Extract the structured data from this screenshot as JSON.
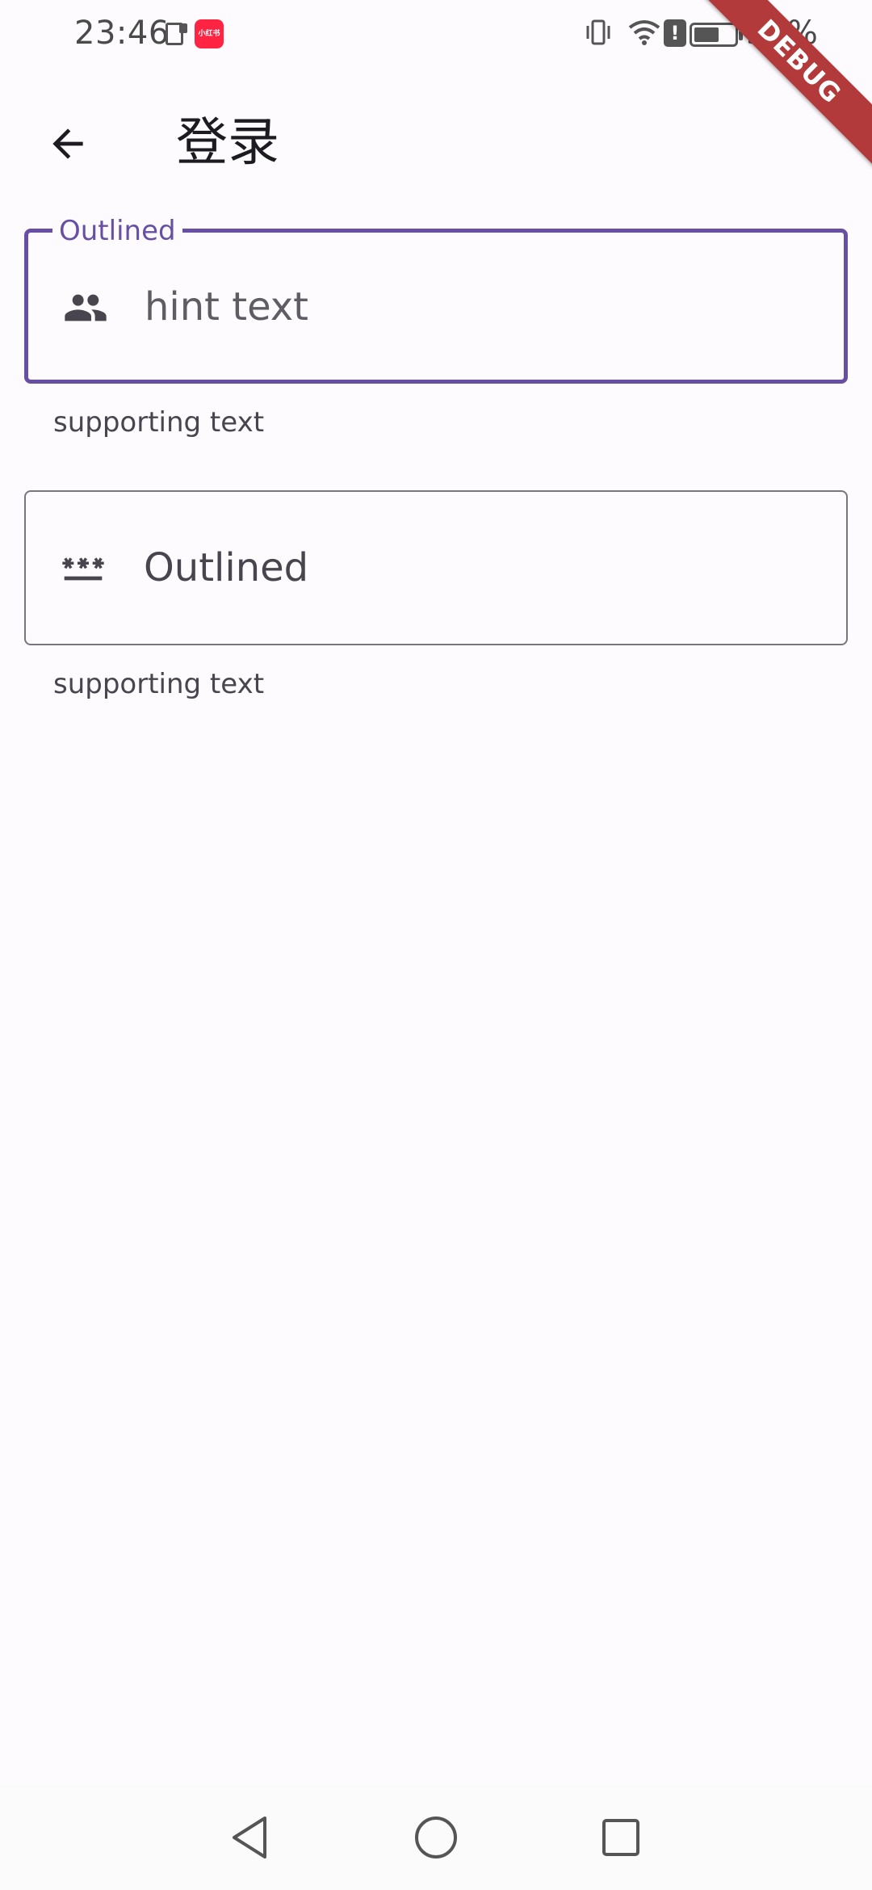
{
  "status_bar": {
    "time": "23:46",
    "notification_app_label": "小红书",
    "battery_text": "55%",
    "battery_level": 0.55
  },
  "debug_banner": {
    "label": "DEBUG"
  },
  "app_bar": {
    "back_icon": "arrow-back-icon",
    "title": "登录"
  },
  "fields": [
    {
      "label": "Outlined",
      "icon": "people-icon",
      "value": "hint text",
      "supporting_text": "supporting text",
      "focused": true
    },
    {
      "icon": "password-icon",
      "value": "Outlined",
      "supporting_text": "supporting text",
      "focused": false
    }
  ],
  "colors": {
    "primary": "#6750A4",
    "outline": "#79747E",
    "background": "#FEFBFF",
    "debug_banner": "#B23A3A"
  },
  "nav_bar": {
    "back_icon": "triangle-back-icon",
    "home_icon": "circle-home-icon",
    "recents_icon": "square-recents-icon"
  }
}
